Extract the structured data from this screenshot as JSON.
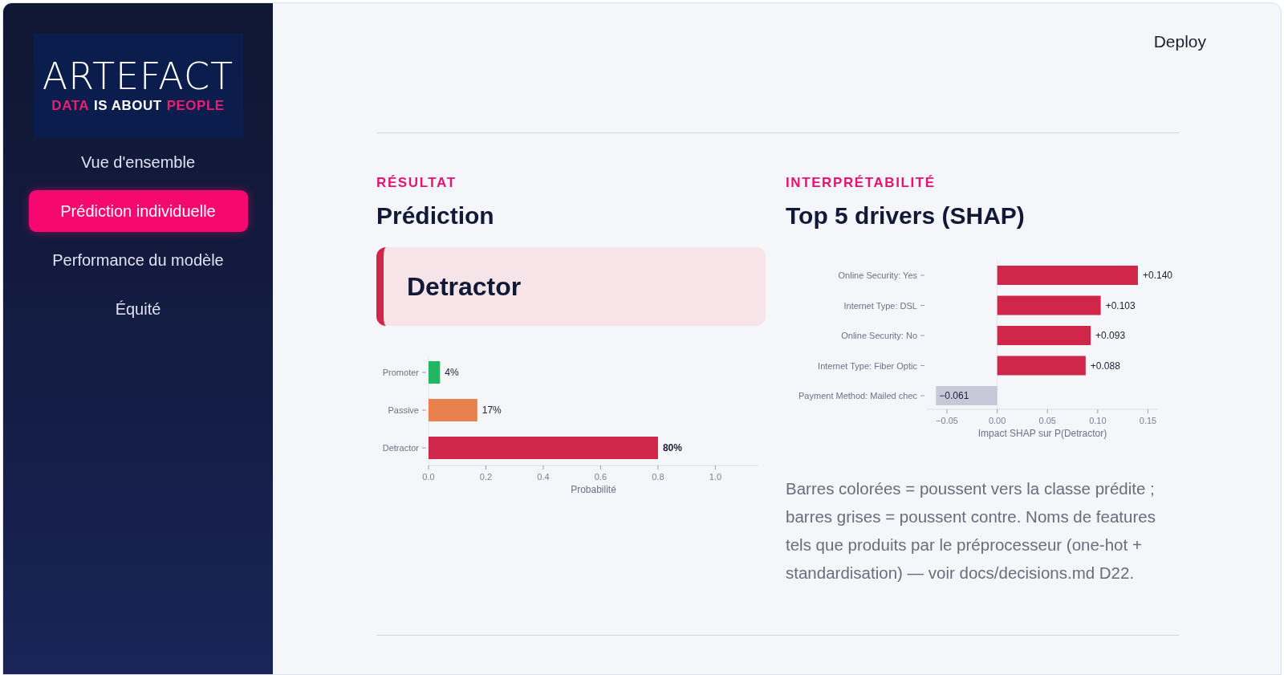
{
  "sidebar": {
    "logo": {
      "wordmark": "ARTEFACT",
      "tagline": [
        {
          "text": "DATA",
          "highlight": true
        },
        {
          "text": "IS ABOUT",
          "highlight": false
        },
        {
          "text": "PEOPLE",
          "highlight": true
        }
      ]
    },
    "items": [
      {
        "label": "Vue d'ensemble",
        "selected": false
      },
      {
        "label": "Prédiction individuelle",
        "selected": true
      },
      {
        "label": "Performance du modèle",
        "selected": false
      },
      {
        "label": "Équité",
        "selected": false
      }
    ]
  },
  "header": {
    "deploy": "Deploy"
  },
  "result": {
    "eyebrow": "RÉSULTAT",
    "title": "Prédiction",
    "prediction": "Detractor",
    "chart_data": {
      "type": "bar",
      "orientation": "horizontal",
      "xlabel": "Probabilité",
      "categories": [
        "Promoter",
        "Passive",
        "Detractor"
      ],
      "values": [
        0.04,
        0.17,
        0.8
      ],
      "colors": [
        "#24b562",
        "#e8804d",
        "#d0264a"
      ],
      "xlim": [
        0,
        1.15
      ],
      "xticks": [
        {
          "value": 0,
          "label": "0.0"
        },
        {
          "value": 0.2,
          "label": "0.2"
        },
        {
          "value": 0.4,
          "label": "0.4"
        },
        {
          "value": 0.6,
          "label": "0.6"
        },
        {
          "value": 0.8,
          "label": "0.8"
        },
        {
          "value": 1,
          "label": "1.0"
        }
      ],
      "value_labels": [
        "4%",
        "17%",
        "80%"
      ]
    }
  },
  "interpret": {
    "eyebrow": "INTERPRÉTABILITÉ",
    "title": "Top 5 drivers (SHAP)",
    "chart_data": {
      "type": "bar",
      "orientation": "horizontal",
      "xlabel": "Impact SHAP sur P(Detractor)",
      "categories": [
        "Online Security: Yes",
        "Internet Type: DSL",
        "Online Security: No",
        "Internet Type: Fiber Optic",
        "Payment Method: Mailed chec"
      ],
      "values": [
        0.14,
        0.103,
        0.093,
        0.088,
        -0.061
      ],
      "colors": [
        "#d0264a",
        "#d0264a",
        "#d0264a",
        "#d0264a",
        "#c8c9d8"
      ],
      "xlim": [
        -0.07,
        0.16
      ],
      "xticks": [
        {
          "value": -0.05,
          "label": "−0.05"
        },
        {
          "value": 0,
          "label": "0.00"
        },
        {
          "value": 0.05,
          "label": "0.05"
        },
        {
          "value": 0.1,
          "label": "0.10"
        },
        {
          "value": 0.15,
          "label": "0.15"
        }
      ],
      "value_labels": [
        "+0.140",
        "+0.103",
        "+0.093",
        "+0.088",
        "−0.061"
      ]
    },
    "note": "Barres colorées = poussent vers la classe prédite ; barres grises = poussent contre. Noms de features tels que produits par le préprocesseur (one-hot + standardisation) — voir docs/decisions.md D22."
  }
}
